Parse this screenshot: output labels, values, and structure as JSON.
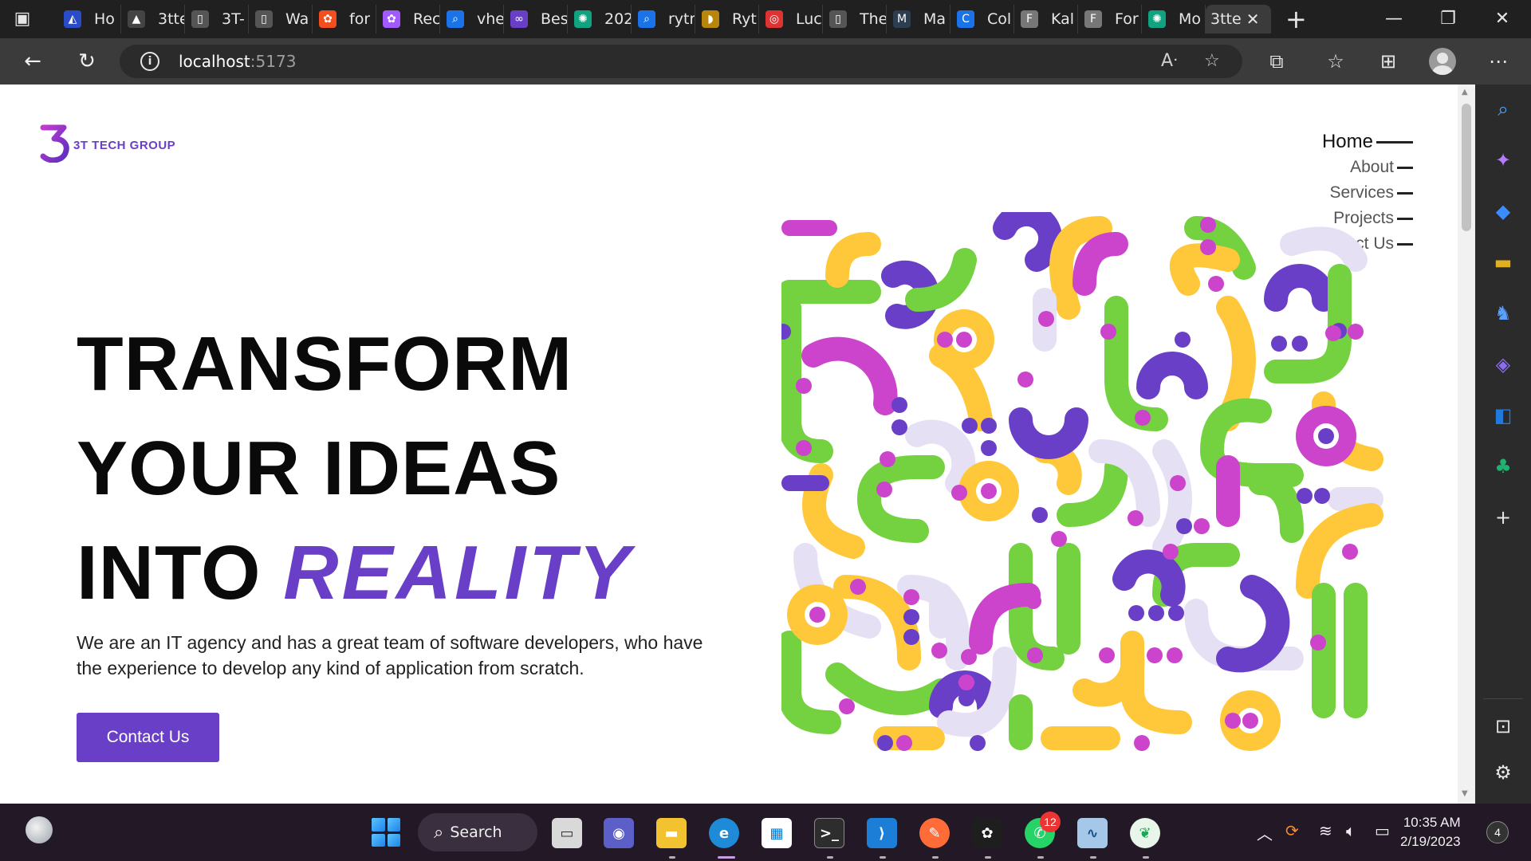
{
  "browser": {
    "tabs": [
      {
        "title": "Ho",
        "icon": "vercel-icon",
        "color": "#2a4cc8"
      },
      {
        "title": "3tte",
        "icon": "triangle-icon",
        "color": "#444444"
      },
      {
        "title": "3T-",
        "icon": "document-icon",
        "color": "#555555"
      },
      {
        "title": "Wa",
        "icon": "document-icon",
        "color": "#555555"
      },
      {
        "title": "for",
        "icon": "figma-icon",
        "color": "#f24e1e"
      },
      {
        "title": "Rec",
        "icon": "figma-icon",
        "color": "#a259ff"
      },
      {
        "title": "vhe",
        "icon": "search-icon",
        "color": "#1a73e8"
      },
      {
        "title": "Bes",
        "icon": "infinity-icon",
        "color": "#6a3fc8"
      },
      {
        "title": "202",
        "icon": "chatgpt-icon",
        "color": "#10a37f"
      },
      {
        "title": "rytr",
        "icon": "search-icon",
        "color": "#1a73e8"
      },
      {
        "title": "Ryt",
        "icon": "bird-icon",
        "color": "#b8860b"
      },
      {
        "title": "Luc",
        "icon": "spiral-icon",
        "color": "#d33"
      },
      {
        "title": "The",
        "icon": "document-icon",
        "color": "#555555"
      },
      {
        "title": "Ma",
        "icon": "m-logo-icon",
        "color": "#2c3e50"
      },
      {
        "title": "Col",
        "icon": "c-logo-icon",
        "color": "#1a73e8"
      },
      {
        "title": "Kal",
        "icon": "f-logo-icon",
        "color": "#777777"
      },
      {
        "title": "For",
        "icon": "f-logo-icon",
        "color": "#777777"
      },
      {
        "title": "Mo",
        "icon": "chatgpt-icon",
        "color": "#10a37f"
      }
    ],
    "active_tab": {
      "title": "3tte",
      "close": "✕"
    },
    "url_host": "localhost",
    "url_port": ":5173"
  },
  "site": {
    "brand": "3T TECH GROUP",
    "nav": [
      {
        "label": "Home",
        "active": true
      },
      {
        "label": "About",
        "active": false
      },
      {
        "label": "Services",
        "active": false
      },
      {
        "label": "Projects",
        "active": false
      },
      {
        "label": "Contact Us",
        "active": false
      }
    ],
    "hero": {
      "line1": "TRANSFORM",
      "line2": "YOUR IDEAS",
      "line3": "INTO ",
      "accent": "REALITY",
      "description": "We are an IT agency and has a great team of software developers, who have the experience to develop any kind of application from scratch.",
      "cta": "Contact Us"
    },
    "colors": {
      "accent": "#6a3fc8",
      "green": "#74d13f",
      "yellow": "#ffc83a",
      "magenta": "#cc44cc",
      "purple": "#6a3fc8",
      "lavender": "#e6e0f5"
    }
  },
  "taskbar": {
    "search_label": "Search",
    "whatsapp_badge": "12",
    "time": "10:35 AM",
    "date": "2/19/2023",
    "notifications": "4"
  }
}
